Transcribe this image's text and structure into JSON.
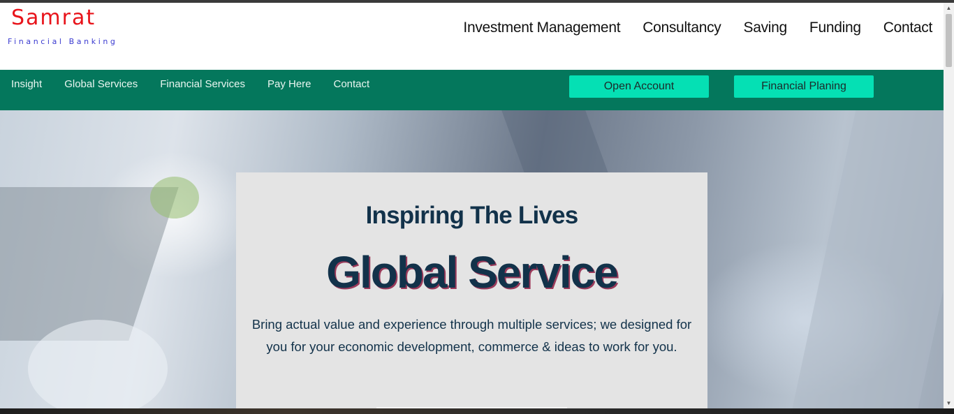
{
  "logo": {
    "title": "Samrat",
    "subtitle": "Financial Banking"
  },
  "main_nav": [
    {
      "label": "Investment Management"
    },
    {
      "label": "Consultancy"
    },
    {
      "label": "Saving"
    },
    {
      "label": "Funding"
    },
    {
      "label": "Contact"
    }
  ],
  "sub_nav": [
    {
      "label": "Insight"
    },
    {
      "label": "Global Services"
    },
    {
      "label": "Financial Services"
    },
    {
      "label": "Pay Here"
    },
    {
      "label": "Contact"
    }
  ],
  "buttons": {
    "open_account": "Open Account",
    "financial_planing": "Financial Planing"
  },
  "hero": {
    "subtitle": "Inspiring The Lives",
    "title": "Global Service",
    "text": "Bring actual value and experience through multiple services; we designed for you for your economic development, commerce & ideas to work for you."
  },
  "scrollbar": {
    "up_icon": "▲",
    "down_icon": "▼"
  },
  "colors": {
    "brand_red": "#e8141b",
    "subtitle_blue": "#3a3ad0",
    "subnav_green": "#04775c",
    "button_aqua": "#05e0b4",
    "heading_navy": "#12324a"
  }
}
